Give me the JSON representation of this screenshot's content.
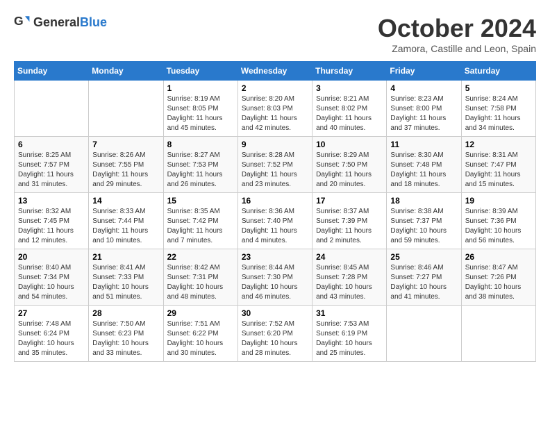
{
  "logo": {
    "text_general": "General",
    "text_blue": "Blue"
  },
  "header": {
    "month": "October 2024",
    "subtitle": "Zamora, Castille and Leon, Spain"
  },
  "weekdays": [
    "Sunday",
    "Monday",
    "Tuesday",
    "Wednesday",
    "Thursday",
    "Friday",
    "Saturday"
  ],
  "weeks": [
    [
      {
        "day": "",
        "info": ""
      },
      {
        "day": "",
        "info": ""
      },
      {
        "day": "1",
        "info": "Sunrise: 8:19 AM\nSunset: 8:05 PM\nDaylight: 11 hours and 45 minutes."
      },
      {
        "day": "2",
        "info": "Sunrise: 8:20 AM\nSunset: 8:03 PM\nDaylight: 11 hours and 42 minutes."
      },
      {
        "day": "3",
        "info": "Sunrise: 8:21 AM\nSunset: 8:02 PM\nDaylight: 11 hours and 40 minutes."
      },
      {
        "day": "4",
        "info": "Sunrise: 8:23 AM\nSunset: 8:00 PM\nDaylight: 11 hours and 37 minutes."
      },
      {
        "day": "5",
        "info": "Sunrise: 8:24 AM\nSunset: 7:58 PM\nDaylight: 11 hours and 34 minutes."
      }
    ],
    [
      {
        "day": "6",
        "info": "Sunrise: 8:25 AM\nSunset: 7:57 PM\nDaylight: 11 hours and 31 minutes."
      },
      {
        "day": "7",
        "info": "Sunrise: 8:26 AM\nSunset: 7:55 PM\nDaylight: 11 hours and 29 minutes."
      },
      {
        "day": "8",
        "info": "Sunrise: 8:27 AM\nSunset: 7:53 PM\nDaylight: 11 hours and 26 minutes."
      },
      {
        "day": "9",
        "info": "Sunrise: 8:28 AM\nSunset: 7:52 PM\nDaylight: 11 hours and 23 minutes."
      },
      {
        "day": "10",
        "info": "Sunrise: 8:29 AM\nSunset: 7:50 PM\nDaylight: 11 hours and 20 minutes."
      },
      {
        "day": "11",
        "info": "Sunrise: 8:30 AM\nSunset: 7:48 PM\nDaylight: 11 hours and 18 minutes."
      },
      {
        "day": "12",
        "info": "Sunrise: 8:31 AM\nSunset: 7:47 PM\nDaylight: 11 hours and 15 minutes."
      }
    ],
    [
      {
        "day": "13",
        "info": "Sunrise: 8:32 AM\nSunset: 7:45 PM\nDaylight: 11 hours and 12 minutes."
      },
      {
        "day": "14",
        "info": "Sunrise: 8:33 AM\nSunset: 7:44 PM\nDaylight: 11 hours and 10 minutes."
      },
      {
        "day": "15",
        "info": "Sunrise: 8:35 AM\nSunset: 7:42 PM\nDaylight: 11 hours and 7 minutes."
      },
      {
        "day": "16",
        "info": "Sunrise: 8:36 AM\nSunset: 7:40 PM\nDaylight: 11 hours and 4 minutes."
      },
      {
        "day": "17",
        "info": "Sunrise: 8:37 AM\nSunset: 7:39 PM\nDaylight: 11 hours and 2 minutes."
      },
      {
        "day": "18",
        "info": "Sunrise: 8:38 AM\nSunset: 7:37 PM\nDaylight: 10 hours and 59 minutes."
      },
      {
        "day": "19",
        "info": "Sunrise: 8:39 AM\nSunset: 7:36 PM\nDaylight: 10 hours and 56 minutes."
      }
    ],
    [
      {
        "day": "20",
        "info": "Sunrise: 8:40 AM\nSunset: 7:34 PM\nDaylight: 10 hours and 54 minutes."
      },
      {
        "day": "21",
        "info": "Sunrise: 8:41 AM\nSunset: 7:33 PM\nDaylight: 10 hours and 51 minutes."
      },
      {
        "day": "22",
        "info": "Sunrise: 8:42 AM\nSunset: 7:31 PM\nDaylight: 10 hours and 48 minutes."
      },
      {
        "day": "23",
        "info": "Sunrise: 8:44 AM\nSunset: 7:30 PM\nDaylight: 10 hours and 46 minutes."
      },
      {
        "day": "24",
        "info": "Sunrise: 8:45 AM\nSunset: 7:28 PM\nDaylight: 10 hours and 43 minutes."
      },
      {
        "day": "25",
        "info": "Sunrise: 8:46 AM\nSunset: 7:27 PM\nDaylight: 10 hours and 41 minutes."
      },
      {
        "day": "26",
        "info": "Sunrise: 8:47 AM\nSunset: 7:26 PM\nDaylight: 10 hours and 38 minutes."
      }
    ],
    [
      {
        "day": "27",
        "info": "Sunrise: 7:48 AM\nSunset: 6:24 PM\nDaylight: 10 hours and 35 minutes."
      },
      {
        "day": "28",
        "info": "Sunrise: 7:50 AM\nSunset: 6:23 PM\nDaylight: 10 hours and 33 minutes."
      },
      {
        "day": "29",
        "info": "Sunrise: 7:51 AM\nSunset: 6:22 PM\nDaylight: 10 hours and 30 minutes."
      },
      {
        "day": "30",
        "info": "Sunrise: 7:52 AM\nSunset: 6:20 PM\nDaylight: 10 hours and 28 minutes."
      },
      {
        "day": "31",
        "info": "Sunrise: 7:53 AM\nSunset: 6:19 PM\nDaylight: 10 hours and 25 minutes."
      },
      {
        "day": "",
        "info": ""
      },
      {
        "day": "",
        "info": ""
      }
    ]
  ]
}
